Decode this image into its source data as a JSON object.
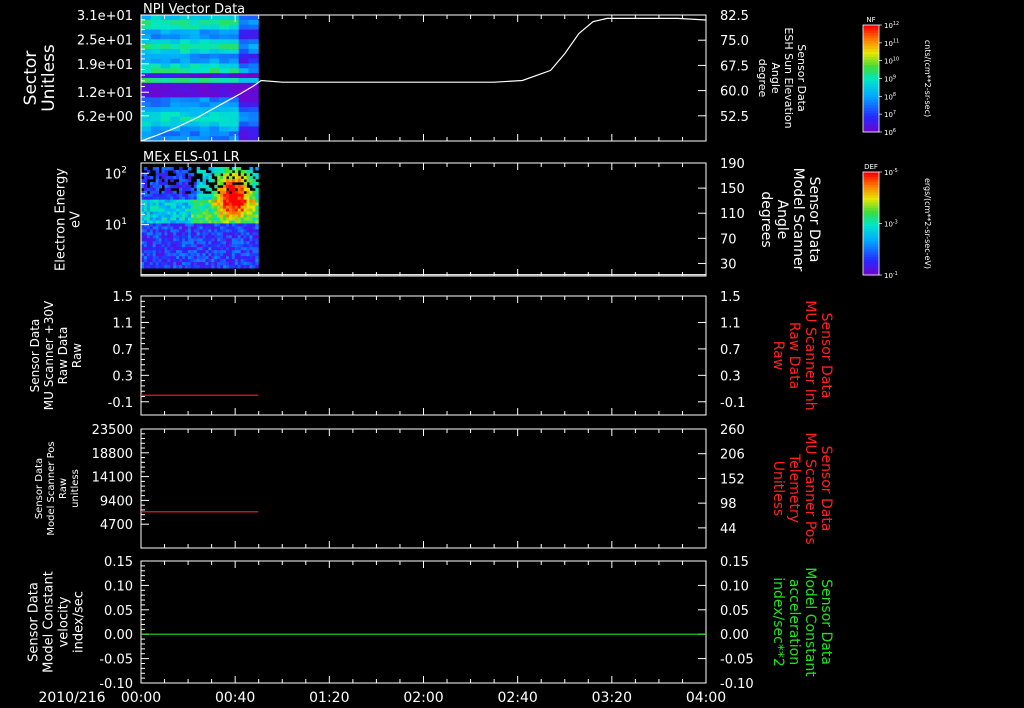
{
  "colors": {
    "background": "#000000",
    "axis": "#ffffff",
    "red_trace": "#ff2020",
    "green_trace": "#20e020",
    "red_label": "#ff2020",
    "green_label": "#20e020"
  },
  "time_axis": {
    "date": "2010/216",
    "ticks": [
      "00:00",
      "00:40",
      "01:20",
      "02:00",
      "02:40",
      "03:20",
      "04:00"
    ],
    "range_hours": [
      0,
      4
    ]
  },
  "chart_data": [
    {
      "type": "heatmap",
      "title": "NPI Vector Data",
      "ylabel_left": [
        "Sector",
        "Unitless"
      ],
      "ylabel_right": [
        "Sensor Data",
        "ESH Sun Elevation",
        "Angle",
        "degree"
      ],
      "left_ticks": [
        "3.1e+01",
        "2.5e+01",
        "1.9e+01",
        "1.2e+01",
        "6.2e+00"
      ],
      "left_range": [
        0,
        31
      ],
      "right_ticks": [
        "82.5",
        "75.0",
        "67.5",
        "60.0",
        "52.5"
      ],
      "right_range": [
        45,
        82.5
      ],
      "heatmap_time_end_hours": 0.83,
      "colorbar": {
        "label": "NF",
        "units": "cnts/(cm**2-sr-sec)",
        "ticks": [
          "10^12",
          "10^11",
          "10^10",
          "10^9",
          "10^8",
          "10^7",
          "10^6"
        ]
      },
      "series": [
        {
          "line": "right_axis",
          "x_hours": [
            0,
            0.1,
            0.25,
            0.4,
            0.55,
            0.7,
            0.8,
            0.85,
            1.0,
            1.5,
            2.0,
            2.5,
            2.7,
            2.9,
            3.0,
            3.1,
            3.2,
            3.3,
            3.5,
            3.8,
            4.0
          ],
          "values": [
            45,
            46.5,
            49,
            52,
            55.5,
            59,
            61.5,
            63,
            62.5,
            62.5,
            62.5,
            62.5,
            63,
            66,
            71,
            77,
            80.5,
            81.5,
            81.5,
            81.5,
            81
          ]
        }
      ]
    },
    {
      "type": "heatmap",
      "title": "MEx ELS-01 LR",
      "ylabel_left": [
        "Electron Energy",
        "eV"
      ],
      "ylabel_right": [
        "Sensor Data",
        "Model Scanner",
        "Angle",
        "degrees"
      ],
      "left_ticks": [
        "10^2",
        "10^1"
      ],
      "left_range_log10": [
        0,
        2.2
      ],
      "right_ticks": [
        "190",
        "150",
        "110",
        "70",
        "30"
      ],
      "right_range": [
        10,
        190
      ],
      "heatmap_time_end_hours": 0.83,
      "colorbar": {
        "label": "DEF",
        "units": "ergs/(cm**2-sr-sec-eV)",
        "ticks": [
          "10^-5",
          "10^-3",
          "10^-1"
        ]
      },
      "series": [
        {
          "line": "right_axis",
          "x_hours": [
            0,
            4
          ],
          "values": [
            12,
            12
          ]
        }
      ]
    },
    {
      "type": "line",
      "ylabel_left": [
        "Sensor Data",
        "MU Scanner +30V",
        "Raw Data",
        "Raw"
      ],
      "ylabel_right": [
        "Sensor Data",
        "MU Scanner Inh",
        "Raw Data",
        "Raw"
      ],
      "left_ticks": [
        "1.5",
        "1.1",
        "0.7",
        "0.3",
        "-0.1"
      ],
      "right_ticks": [
        "1.5",
        "1.1",
        "0.7",
        "0.3",
        "-0.1"
      ],
      "y_range": [
        -0.3,
        1.5
      ],
      "series": [
        {
          "axis": "left",
          "color": "red",
          "x_hours": [
            0,
            0.83
          ],
          "values": [
            0,
            0
          ]
        }
      ]
    },
    {
      "type": "line",
      "ylabel_left": [
        "Sensor Data",
        "Model Scanner Pos",
        "Raw",
        "unitless"
      ],
      "ylabel_right": [
        "Sensor Data",
        "MU Scanner Pos",
        "Telemetry",
        "Unitless"
      ],
      "left_ticks": [
        "23500",
        "18800",
        "14100",
        "9400",
        "4700"
      ],
      "left_range": [
        0,
        23500
      ],
      "right_ticks": [
        "260",
        "206",
        "152",
        "98",
        "44"
      ],
      "right_range": [
        0,
        260
      ],
      "series": [
        {
          "axis": "right",
          "color": "red",
          "x_hours": [
            0,
            0.83
          ],
          "values": [
            79,
            79
          ]
        }
      ]
    },
    {
      "type": "line",
      "ylabel_left": [
        "Sensor Data",
        "Model Constant",
        "velocity",
        "index/sec"
      ],
      "ylabel_right": [
        "Sensor Data",
        "Model Constant",
        "acceleration",
        "index/sec**2"
      ],
      "left_ticks": [
        "0.15",
        "0.10",
        "0.05",
        "0.00",
        "-0.05",
        "-0.10"
      ],
      "right_ticks": [
        "0.15",
        "0.10",
        "0.05",
        "0.00",
        "-0.05",
        "-0.10"
      ],
      "y_range": [
        -0.1,
        0.15
      ],
      "series": [
        {
          "axis": "right",
          "color": "green",
          "x_hours": [
            0,
            4
          ],
          "values": [
            0,
            0
          ]
        }
      ]
    }
  ]
}
